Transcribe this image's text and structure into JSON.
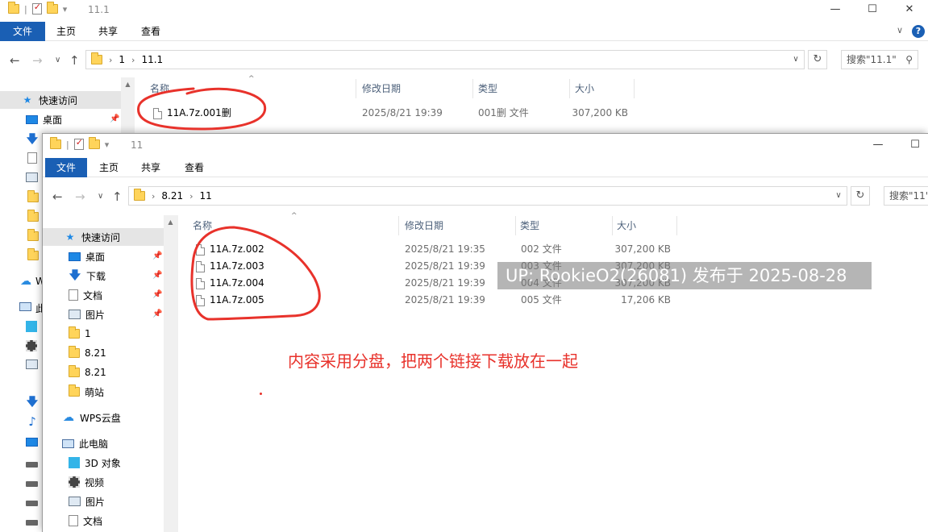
{
  "back_window": {
    "title": "11.1",
    "ribbon_tabs": [
      "文件",
      "主页",
      "共享",
      "查看"
    ],
    "path": [
      "1",
      "11.1"
    ],
    "search_placeholder": "搜索\"11.1\"",
    "columns": [
      "名称",
      "修改日期",
      "类型",
      "大小"
    ],
    "files": [
      {
        "name": "11A.7z.001删",
        "date": "2025/8/21 19:39",
        "type": "001删 文件",
        "size": "307,200 KB"
      }
    ],
    "nav": [
      {
        "label": "快速访问"
      },
      {
        "label": "桌面"
      }
    ],
    "nav_peek_letters": [
      "W",
      "此"
    ]
  },
  "front_window": {
    "title": "11",
    "ribbon_tabs": [
      "文件",
      "主页",
      "共享",
      "查看"
    ],
    "path": [
      "8.21",
      "11"
    ],
    "search_placeholder": "搜索\"11\"",
    "columns": [
      "名称",
      "修改日期",
      "类型",
      "大小"
    ],
    "files": [
      {
        "name": "11A.7z.002",
        "date": "2025/8/21 19:35",
        "type": "002 文件",
        "size": "307,200 KB"
      },
      {
        "name": "11A.7z.003",
        "date": "2025/8/21 19:39",
        "type": "003 文件",
        "size": "307,200 KB"
      },
      {
        "name": "11A.7z.004",
        "date": "2025/8/21 19:39",
        "type": "004 文件",
        "size": "307,200 KB"
      },
      {
        "name": "11A.7z.005",
        "date": "2025/8/21 19:39",
        "type": "005 文件",
        "size": "17,206 KB"
      }
    ],
    "nav": [
      {
        "label": "快速访问",
        "icon": "star-icon"
      },
      {
        "label": "桌面",
        "icon": "desktop-icon",
        "pinned": true
      },
      {
        "label": "下载",
        "icon": "download-icon",
        "pinned": true
      },
      {
        "label": "文档",
        "icon": "document-icon",
        "pinned": true
      },
      {
        "label": "图片",
        "icon": "pictures-icon",
        "pinned": true
      },
      {
        "label": "1",
        "icon": "folder-icon"
      },
      {
        "label": "8.21",
        "icon": "folder-icon"
      },
      {
        "label": "8.21",
        "icon": "folder-icon"
      },
      {
        "label": "萌站",
        "icon": "folder-icon"
      },
      {
        "label": "WPS云盘",
        "icon": "cloud-icon"
      },
      {
        "label": "此电脑",
        "icon": "pc-icon"
      },
      {
        "label": "3D 对象",
        "icon": "3d-objects-icon"
      },
      {
        "label": "视频",
        "icon": "video-icon"
      },
      {
        "label": "图片",
        "icon": "pictures-icon"
      },
      {
        "label": "文档",
        "icon": "document-icon"
      }
    ]
  },
  "watermark": "UP: RookieO2(26081) 发布于 2025-08-28",
  "annotation": "内容采用分盘，把两个链接下载放在一起",
  "colors": {
    "accent": "#1a5fb4",
    "annotation_red": "#e8322b",
    "selected_nav": "#e5e5e5"
  }
}
